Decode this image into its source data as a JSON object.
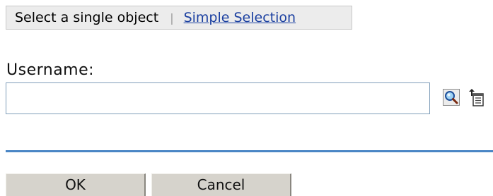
{
  "mode_bar": {
    "current_mode": "Select a single object",
    "separator": "|",
    "alternate_mode_link": "Simple Selection"
  },
  "form": {
    "username_label": "Username:",
    "username_value": ""
  },
  "icons": {
    "search": "search-icon",
    "history": "history-list-icon"
  },
  "buttons": {
    "ok": "OK",
    "cancel": "Cancel"
  },
  "colors": {
    "divider": "#4a86c5",
    "link": "#1a3fa0"
  }
}
